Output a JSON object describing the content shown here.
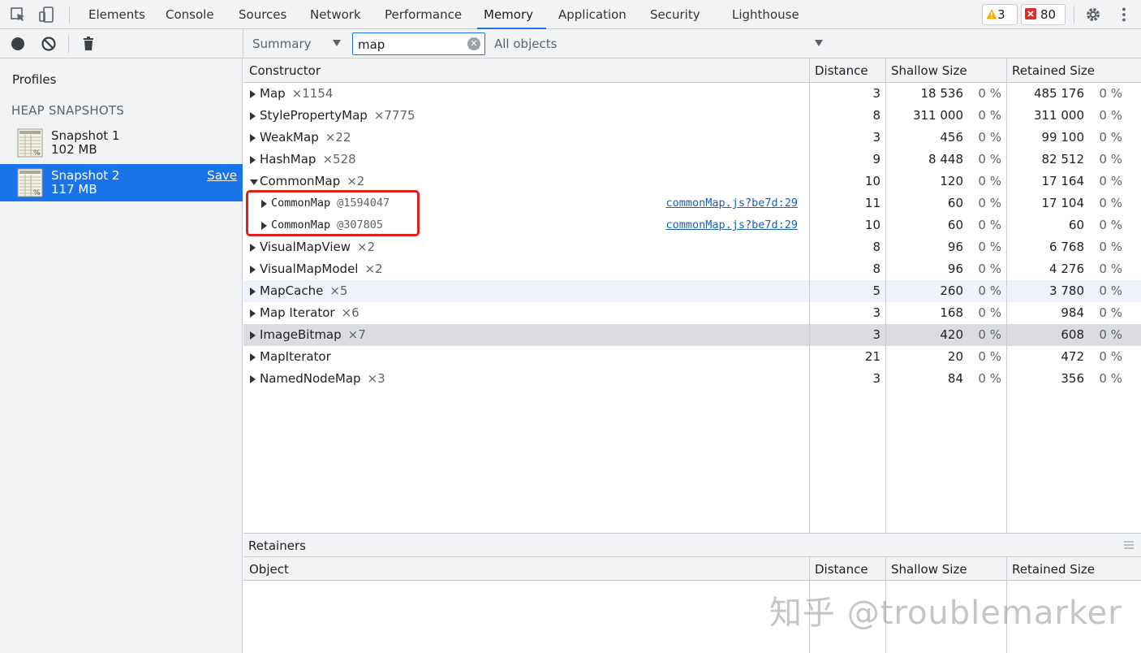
{
  "tabs": [
    {
      "label": "Elements"
    },
    {
      "label": "Console"
    },
    {
      "label": "Sources"
    },
    {
      "label": "Network"
    },
    {
      "label": "Performance"
    },
    {
      "label": "Memory",
      "active": true
    },
    {
      "label": "Application"
    },
    {
      "label": "Security"
    },
    {
      "label": "Lighthouse"
    }
  ],
  "warnings": "3",
  "errors": "80",
  "toolbar": {
    "view": "Summary",
    "filter_value": "map",
    "objects_filter": "All objects"
  },
  "sidebar": {
    "title": "Profiles",
    "section": "HEAP SNAPSHOTS",
    "snapshots": [
      {
        "name": "Snapshot 1",
        "size": "102 MB"
      },
      {
        "name": "Snapshot 2",
        "size": "117 MB",
        "save": "Save"
      }
    ]
  },
  "table": {
    "headers": {
      "constructor": "Constructor",
      "distance": "Distance",
      "shallow": "Shallow Size",
      "retained": "Retained Size"
    },
    "rows": [
      {
        "name": "Map",
        "count": "×1154",
        "distance": "3",
        "shallow": "18 536",
        "shallow_pct": "0 %",
        "retained": "485 176",
        "retained_pct": "0 %"
      },
      {
        "name": "StylePropertyMap",
        "count": "×7775",
        "distance": "8",
        "shallow": "311 000",
        "shallow_pct": "0 %",
        "retained": "311 000",
        "retained_pct": "0 %"
      },
      {
        "name": "WeakMap",
        "count": "×22",
        "distance": "3",
        "shallow": "456",
        "shallow_pct": "0 %",
        "retained": "99 100",
        "retained_pct": "0 %"
      },
      {
        "name": "HashMap",
        "count": "×528",
        "distance": "9",
        "shallow": "8 448",
        "shallow_pct": "0 %",
        "retained": "82 512",
        "retained_pct": "0 %"
      },
      {
        "name": "CommonMap",
        "count": "×2",
        "distance": "10",
        "shallow": "120",
        "shallow_pct": "0 %",
        "retained": "17 164",
        "retained_pct": "0 %"
      },
      {
        "name": "CommonMap",
        "count": "@1594047",
        "link": "commonMap.js?be7d:29",
        "distance": "11",
        "shallow": "60",
        "shallow_pct": "0 %",
        "retained": "17 104",
        "retained_pct": "0 %"
      },
      {
        "name": "CommonMap",
        "count": "@307805",
        "link": "commonMap.js?be7d:29",
        "distance": "10",
        "shallow": "60",
        "shallow_pct": "0 %",
        "retained": "60",
        "retained_pct": "0 %"
      },
      {
        "name": "VisualMapView",
        "count": "×2",
        "distance": "8",
        "shallow": "96",
        "shallow_pct": "0 %",
        "retained": "6 768",
        "retained_pct": "0 %"
      },
      {
        "name": "VisualMapModel",
        "count": "×2",
        "distance": "8",
        "shallow": "96",
        "shallow_pct": "0 %",
        "retained": "4 276",
        "retained_pct": "0 %"
      },
      {
        "name": "MapCache",
        "count": "×5",
        "distance": "5",
        "shallow": "260",
        "shallow_pct": "0 %",
        "retained": "3 780",
        "retained_pct": "0 %"
      },
      {
        "name": "Map Iterator",
        "count": "×6",
        "distance": "3",
        "shallow": "168",
        "shallow_pct": "0 %",
        "retained": "984",
        "retained_pct": "0 %"
      },
      {
        "name": "ImageBitmap",
        "count": "×7",
        "distance": "3",
        "shallow": "420",
        "shallow_pct": "0 %",
        "retained": "608",
        "retained_pct": "0 %"
      },
      {
        "name": "MapIterator",
        "count": "",
        "distance": "21",
        "shallow": "20",
        "shallow_pct": "0 %",
        "retained": "472",
        "retained_pct": "0 %"
      },
      {
        "name": "NamedNodeMap",
        "count": "×3",
        "distance": "3",
        "shallow": "84",
        "shallow_pct": "0 %",
        "retained": "356",
        "retained_pct": "0 %"
      }
    ]
  },
  "retainers": {
    "title": "Retainers",
    "headers": {
      "object": "Object",
      "distance": "Distance",
      "shallow": "Shallow Size",
      "retained": "Retained Size"
    }
  },
  "watermark": "知乎 @troublemarker",
  "colors": {
    "accent": "#1a73e8",
    "highlight": "#e0201b",
    "link": "#1a5fb4"
  }
}
